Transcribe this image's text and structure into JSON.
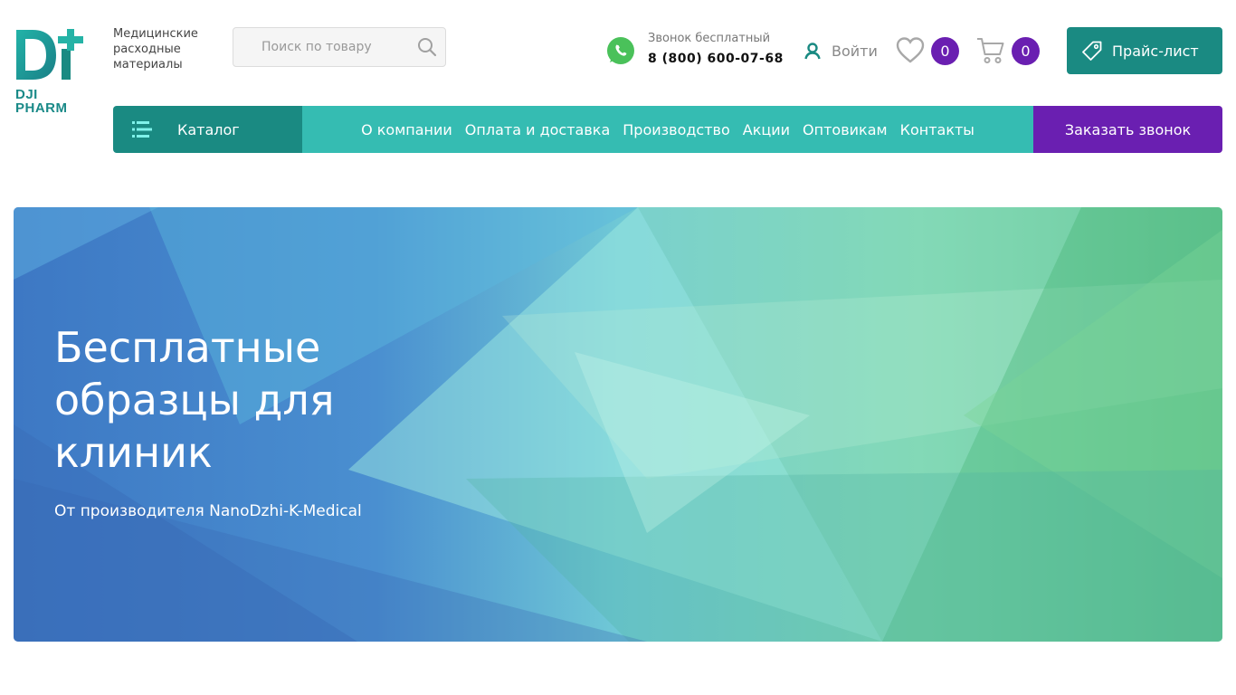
{
  "brand": {
    "logo_text_line1": "DJI",
    "logo_text_line2": "PHARM",
    "tagline": "Медицинские расходные материалы",
    "colors": {
      "teal": "#1a8a82",
      "light_teal": "#35bcb2",
      "purple": "#6a1fb1"
    }
  },
  "search": {
    "placeholder": "Поиск по товару",
    "icon": "search-icon"
  },
  "contact": {
    "label": "Звонок бесплатный",
    "phone": "8 (800) 600-07-68",
    "icon": "whatsapp-icon"
  },
  "account": {
    "login_label": "Войти",
    "icon": "user-icon"
  },
  "favorites": {
    "count": "0",
    "icon": "heart-icon"
  },
  "cart": {
    "count": "0",
    "icon": "cart-icon"
  },
  "price_list": {
    "label": "Прайс-лист",
    "icon": "price-tag-icon"
  },
  "nav": {
    "catalog_label": "Каталог",
    "links": [
      "О компании",
      "Оплата и доставка",
      "Производство",
      "Акции",
      "Оптовикам",
      "Контакты"
    ],
    "callback_label": "Заказать звонок"
  },
  "hero": {
    "title": "Бесплатные образцы для клиник",
    "subtitle": "От производителя NanoDzhi-K-Medical"
  }
}
